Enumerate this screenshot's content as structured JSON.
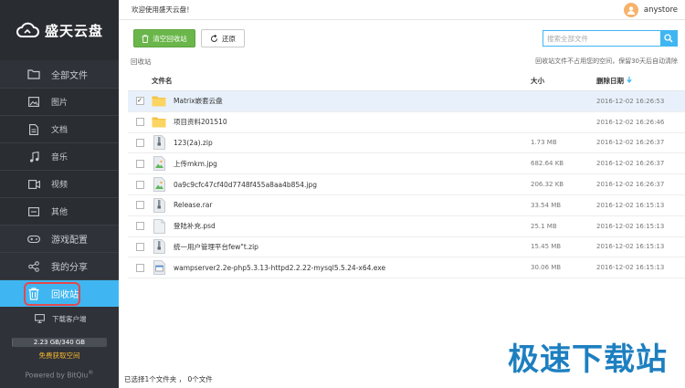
{
  "sidebar": {
    "brand": "盛天云盘",
    "items": [
      {
        "label": "全部文件",
        "icon": "folder-icon"
      },
      {
        "label": "图片",
        "icon": "image-icon"
      },
      {
        "label": "文档",
        "icon": "document-icon"
      },
      {
        "label": "音乐",
        "icon": "music-icon"
      },
      {
        "label": "视频",
        "icon": "video-icon"
      },
      {
        "label": "其他",
        "icon": "other-icon"
      },
      {
        "label": "游戏配置",
        "icon": "gamepad-icon"
      },
      {
        "label": "我的分享",
        "icon": "share-icon"
      },
      {
        "label": "回收站",
        "icon": "trash-icon"
      }
    ],
    "client_label": "下载客户端",
    "storage_text": "2.23 GB/340 GB",
    "storage_used_fraction": 0.0066,
    "more_space": "免费获取空间",
    "powered_by": "Powered by BitQiu",
    "powered_mark": "®"
  },
  "header": {
    "welcome": "欢迎使用盛天云盘！",
    "username": "anystore"
  },
  "toolbar": {
    "empty_label": "清空回收站",
    "restore_label": "还原",
    "search_placeholder": "搜索全部文件"
  },
  "breadcrumb": "回收站",
  "notice": "回收站文件不占用您的空间，保留30天后自动清除",
  "table": {
    "headers": {
      "name": "文件名",
      "size": "大小",
      "date": "删除日期"
    },
    "rows": [
      {
        "name": "Matrix嵌套云盘",
        "size": "",
        "date": "2016-12-02 16:26:53",
        "type": "folder",
        "checked": true
      },
      {
        "name": "项目资料201510",
        "size": "",
        "date": "2016-12-02 16:26:46",
        "type": "folder",
        "checked": false
      },
      {
        "name": "123(2a).zip",
        "size": "1.73 MB",
        "date": "2016-12-02 16:26:37",
        "type": "zip",
        "checked": false
      },
      {
        "name": "上传mkm.jpg",
        "size": "682.64 KB",
        "date": "2016-12-02 16:26:37",
        "type": "image",
        "checked": false
      },
      {
        "name": "0a9c9cfc47cf40d7748f455a8aa4b854.jpg",
        "size": "206.32 KB",
        "date": "2016-12-02 16:26:37",
        "type": "image",
        "checked": false
      },
      {
        "name": "Release.rar",
        "size": "33.54 MB",
        "date": "2016-12-02 16:15:13",
        "type": "zip",
        "checked": false
      },
      {
        "name": "登陆补充.psd",
        "size": "25.1 MB",
        "date": "2016-12-02 16:15:13",
        "type": "file",
        "checked": false
      },
      {
        "name": "统一用户管理平台few\"t.zip",
        "size": "15.45 MB",
        "date": "2016-12-02 16:15:13",
        "type": "zip",
        "checked": false
      },
      {
        "name": "wampserver2.2e-php5.3.13-httpd2.2.22-mysql5.5.24-x64.exe",
        "size": "30.06 MB",
        "date": "2016-12-02 16:15:13",
        "type": "exe",
        "checked": false
      }
    ]
  },
  "status": "已选择1个文件夹 ， 0个文件",
  "watermark": "极速下载站",
  "colors": {
    "accent": "#3fb6f2",
    "green": "#6ab64a",
    "sidebar": "#2f3238",
    "highlight": "#e5484d"
  }
}
